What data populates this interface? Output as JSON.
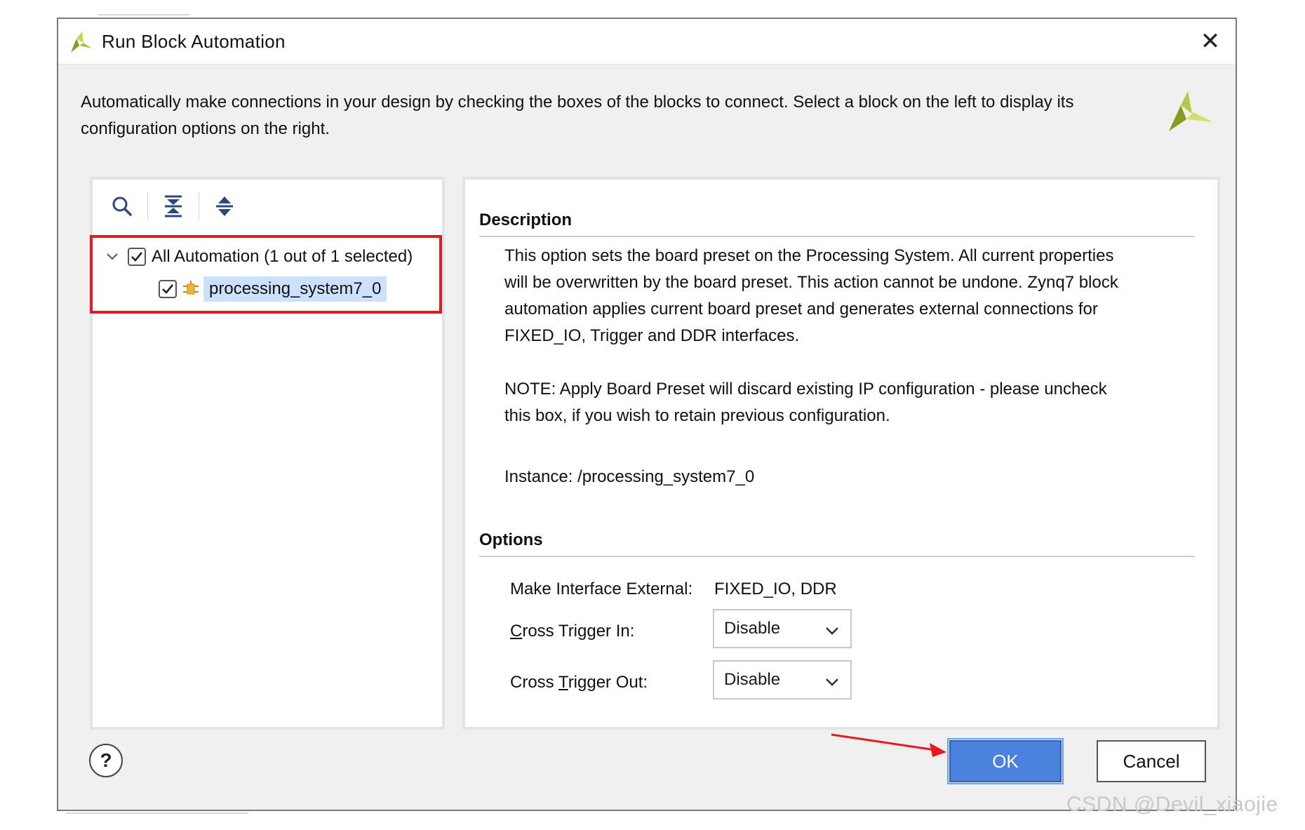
{
  "dialog": {
    "title": "Run Block Automation",
    "close_label": "✕",
    "intro_line1": "Automatically make connections in your design by checking the boxes of the blocks to connect. Select a block on the left to display its",
    "intro_line2": "configuration options on the right."
  },
  "tree": {
    "toolbar_icons": [
      "search-icon",
      "collapse-all-icon",
      "expand-all-icon"
    ],
    "root_label": "All Automation (1 out of 1 selected)",
    "root_checked": true,
    "child_label": "processing_system7_0",
    "child_checked": true
  },
  "description": {
    "heading": "Description",
    "line1": "This option sets the board preset on the Processing System. All current properties",
    "line2": "will be overwritten by the board preset. This action cannot be undone. Zynq7 block",
    "line3": "automation applies current board preset and generates external connections for",
    "line4": "FIXED_IO, Trigger and DDR interfaces.",
    "note1": "NOTE: Apply Board Preset will discard existing IP configuration - please uncheck",
    "note2": "this box, if you wish to retain previous configuration.",
    "instance": "Instance: /processing_system7_0"
  },
  "options": {
    "heading": "Options",
    "make_external_label": "Make Interface External:",
    "make_external_value": "FIXED_IO, DDR",
    "cross_in_label_prefix": "",
    "cross_in_label_mnemonic": "C",
    "cross_in_label_rest": "ross Trigger In:",
    "cross_in_value": "Disable",
    "cross_out_label_prefix": "Cross ",
    "cross_out_label_mnemonic": "T",
    "cross_out_label_rest": "rigger Out:",
    "cross_out_value": "Disable"
  },
  "footer": {
    "help_label": "?",
    "ok_label": "OK",
    "cancel_label": "Cancel"
  },
  "watermark": "CSDN @Devil_xiaojie",
  "colors": {
    "accent_blue": "#4a82dd",
    "highlight_red": "#e8191c",
    "selection_bg": "#cce1fb",
    "logo_green": "#8a9a1f",
    "logo_yellow": "#c8d64b"
  }
}
